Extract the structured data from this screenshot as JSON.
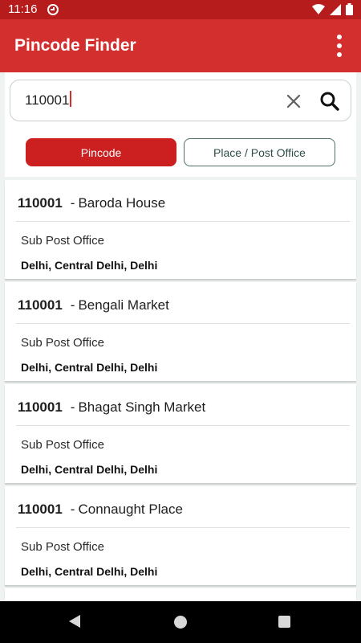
{
  "status_bar": {
    "time": "11:16"
  },
  "app_bar": {
    "title": "Pincode Finder",
    "menu_icon": "more-vert-icon"
  },
  "search": {
    "value": "110001",
    "clear_icon": "close-icon",
    "search_icon": "search-icon"
  },
  "tabs": [
    {
      "label": "Pincode",
      "selected": true
    },
    {
      "label": "Place / Post Office",
      "selected": false
    }
  ],
  "results": [
    {
      "pincode": "110001",
      "name": "Baroda House",
      "type": "Sub Post Office",
      "location": "Delhi, Central Delhi, Delhi"
    },
    {
      "pincode": "110001",
      "name": "Bengali Market",
      "type": "Sub Post Office",
      "location": "Delhi, Central Delhi, Delhi"
    },
    {
      "pincode": "110001",
      "name": "Bhagat Singh Market",
      "type": "Sub Post Office",
      "location": "Delhi, Central Delhi, Delhi"
    },
    {
      "pincode": "110001",
      "name": "Connaught Place",
      "type": "Sub Post Office",
      "location": "Delhi, Central Delhi, Delhi"
    }
  ],
  "colors": {
    "primary": "#d32f2f",
    "status_bar": "#b71c1c",
    "accent_outline": "#4e6e6a"
  }
}
